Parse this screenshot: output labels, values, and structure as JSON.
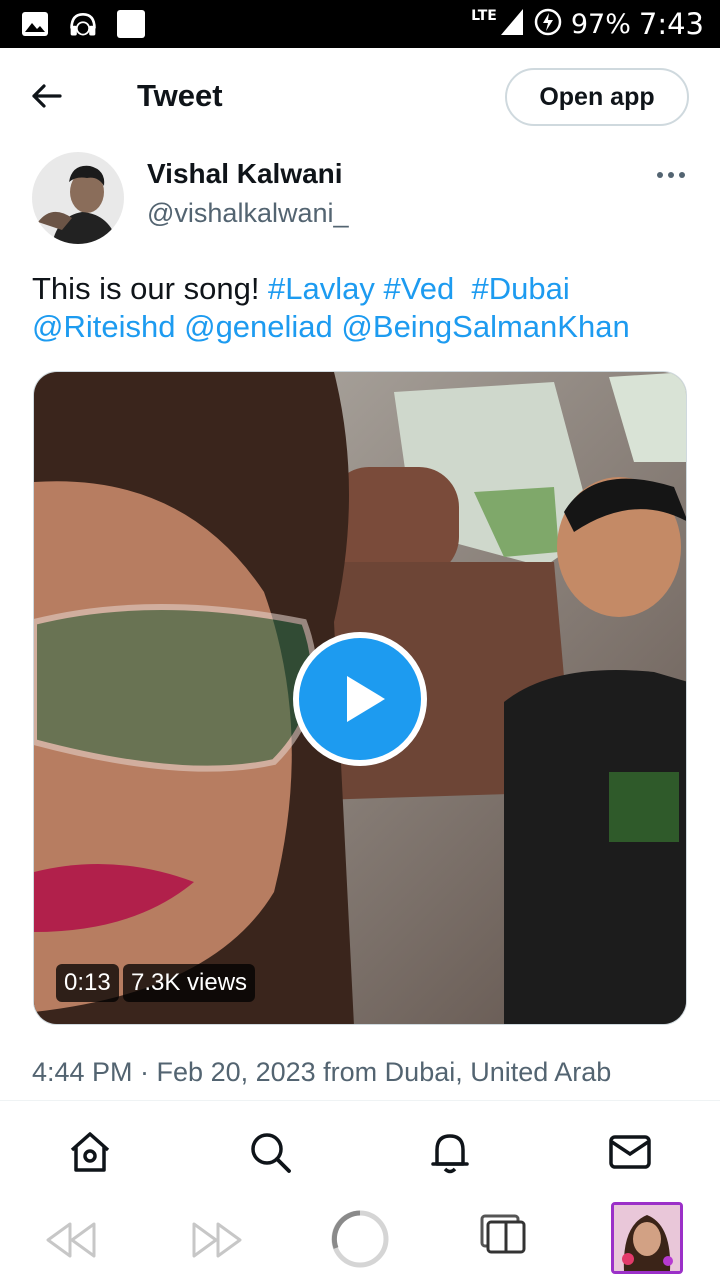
{
  "status_bar": {
    "network": "LTE",
    "battery": "97%",
    "time": "7:43"
  },
  "header": {
    "title": "Tweet",
    "open_app_label": "Open app"
  },
  "tweet": {
    "author_name": "Vishal Kalwani",
    "author_handle": "@vishalkalwani_",
    "text_prefix": "This is our song! ",
    "hashtags": [
      "#Lavlay",
      "#Ved",
      "#Dubai"
    ],
    "mentions": [
      "@Riteishd",
      "@geneliad",
      "@BeingSalmanKhan"
    ],
    "video_duration": "0:13",
    "video_views": "7.3K views",
    "timestamp": "4:44 PM · Feb 20, 2023 from Dubai, United Arab"
  },
  "bottom_nav": {
    "items": [
      "home-icon",
      "search-icon",
      "bell-icon",
      "mail-icon"
    ]
  },
  "browser_bar": {
    "items": [
      "rewind-icon",
      "fast-forward-icon",
      "reload-icon",
      "tabs-icon",
      "profile-thumbnail"
    ]
  },
  "colors": {
    "accent": "#1d9bf0",
    "text": "#0f1419",
    "secondary": "#536471"
  }
}
